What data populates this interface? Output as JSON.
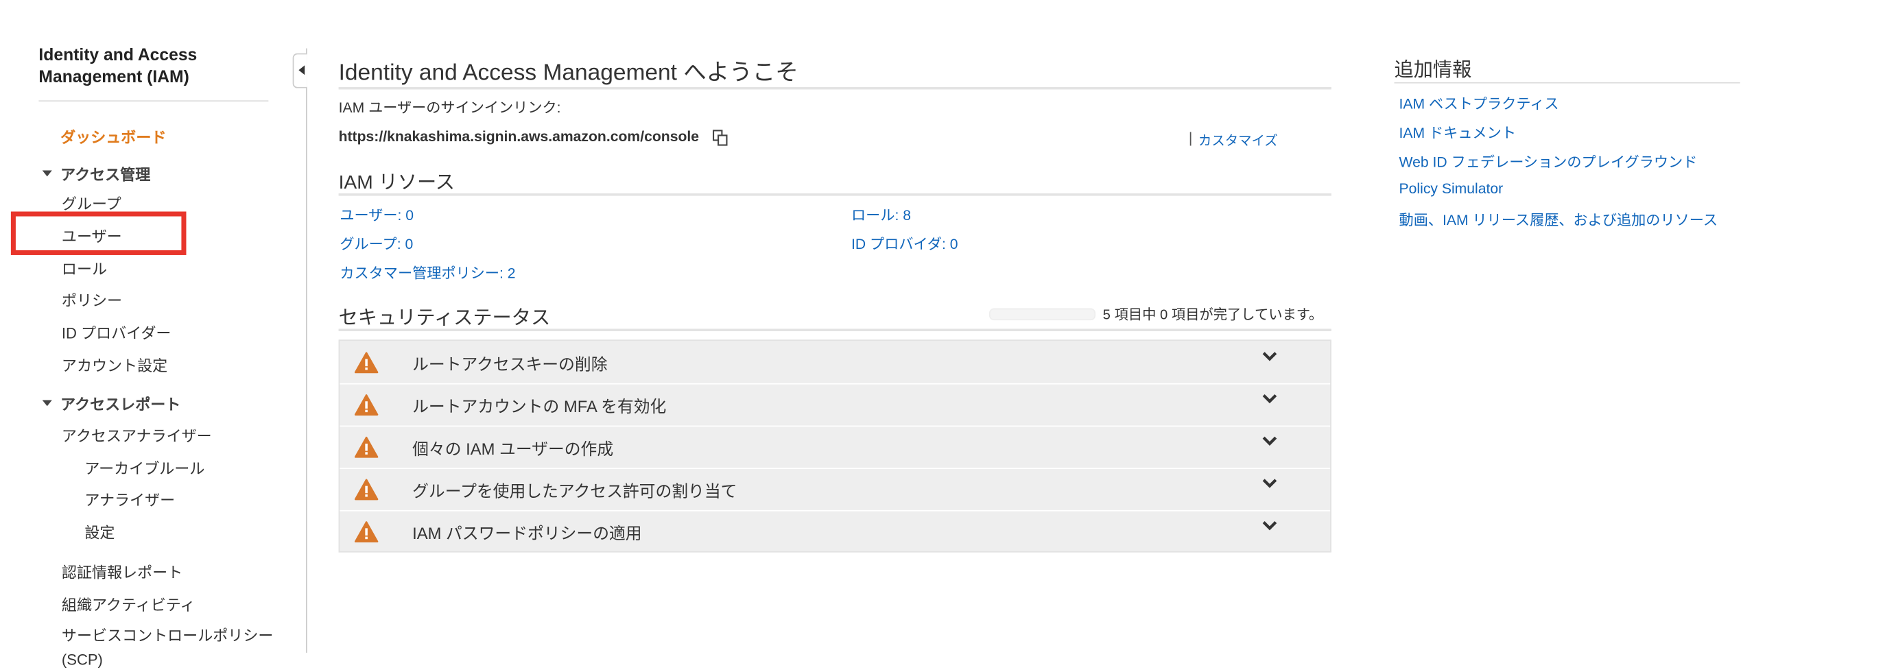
{
  "sidebar": {
    "title_line1": "Identity and Access",
    "title_line2": "Management (IAM)",
    "dashboard": "ダッシュボード",
    "access_management": {
      "label": "アクセス管理",
      "items": [
        "グループ",
        "ユーザー",
        "ロール",
        "ポリシー",
        "ID プロバイダー",
        "アカウント設定"
      ]
    },
    "access_reports": {
      "label": "アクセスレポート",
      "analyzer": "アクセスアナライザー",
      "analyzer_items": [
        "アーカイブルール",
        "アナライザー",
        "設定"
      ],
      "items": [
        "認証情報レポート",
        "組織アクティビティ",
        "サービスコントロールポリシー (SCP)"
      ]
    }
  },
  "main": {
    "title": "Identity and Access Management へようこそ",
    "signin_label": "IAM ユーザーのサインインリンク:",
    "signin_url": "https://knakashima.signin.aws.amazon.com/console",
    "customize_sep": "|",
    "customize": "カスタマイズ",
    "resources_title": "IAM リソース",
    "resources": {
      "users": "ユーザー: 0",
      "roles": "ロール: 8",
      "groups": "グループ: 0",
      "id_providers": "ID プロバイダ: 0",
      "customer_policies": "カスタマー管理ポリシー: 2"
    },
    "security_title": "セキュリティステータス",
    "progress_text": "5 項目中 0 項目が完了しています。",
    "progress_fraction": 0,
    "security_items": [
      "ルートアクセスキーの削除",
      "ルートアカウントの MFA を有効化",
      "個々の IAM ユーザーの作成",
      "グループを使用したアクセス許可の割り当て",
      "IAM パスワードポリシーの適用"
    ]
  },
  "side_info": {
    "title": "追加情報",
    "links": [
      "IAM ベストプラクティス",
      "IAM ドキュメント",
      "Web ID フェデレーションのプレイグラウンド",
      "Policy Simulator",
      "動画、IAM リリース履歴、および追加のリソース"
    ]
  },
  "colors": {
    "accent_orange": "#e07b1d",
    "link_blue": "#1166bb",
    "highlight_red": "#e8352b",
    "warning": "#d9782b"
  }
}
